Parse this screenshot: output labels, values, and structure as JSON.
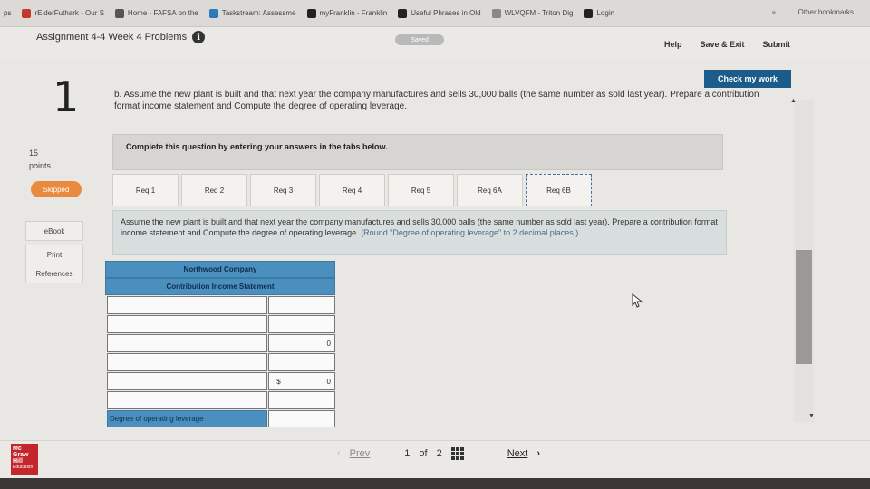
{
  "bookmarks": [
    {
      "label": "ps",
      "color": ""
    },
    {
      "label": "rElderFuthark - Our S",
      "color": "#c0392b"
    },
    {
      "label": "Home - FAFSA on the",
      "color": "#555555"
    },
    {
      "label": "Taskstream: Assessme",
      "color": "#2c7ab8"
    },
    {
      "label": "myFranklin - Franklin",
      "color": "#222222"
    },
    {
      "label": "Useful Phrases in Old",
      "color": "#222222"
    },
    {
      "label": "WLVQFM - Triton Dig",
      "color": "#888888"
    },
    {
      "label": "Login",
      "color": "#222222"
    }
  ],
  "bookmarks_chevron": "»",
  "other_bookmarks": "Other bookmarks",
  "header": {
    "assignment_title": "Assignment 4-4 Week 4 Problems",
    "info": "i",
    "saved": "Saved",
    "help": "Help",
    "save_exit": "Save & Exit",
    "submit": "Submit"
  },
  "sidebar": {
    "question_number": "1",
    "points_value": "15",
    "points_label": "points",
    "status": "Skipped",
    "ebook": "eBook",
    "print": "Print",
    "references": "References"
  },
  "main": {
    "check_my_work": "Check my work",
    "question_text": "b. Assume the new plant is built and that next year the company manufactures and sells 30,000 balls (the same number as sold last year). Prepare a contribution format income statement and Compute the degree of operating leverage.",
    "complete_instruction": "Complete this question by entering your answers in the tabs below.",
    "tabs": [
      "Req 1",
      "Req 2",
      "Req 3",
      "Req 4",
      "Req 5",
      "Req 6A",
      "Req 6B"
    ],
    "active_tab": "Req 6B",
    "panel_text": "Assume the new plant is built and that next year the company manufactures and sells 30,000 balls (the same number as sold last year). Prepare a contribution format income statement and Compute the degree of operating leverage.",
    "panel_hint": "(Round \"Degree of operating leverage\" to 2 decimal places.)"
  },
  "statement": {
    "company": "Northwood Company",
    "title": "Contribution Income Statement",
    "rows": [
      {
        "label": "",
        "value": "",
        "dollar": ""
      },
      {
        "label": "",
        "value": "",
        "dollar": ""
      },
      {
        "label": "",
        "value": "0",
        "dollar": ""
      },
      {
        "label": "",
        "value": "",
        "dollar": ""
      },
      {
        "label": "",
        "value": "0",
        "dollar": "$"
      },
      {
        "label": "",
        "value": "",
        "dollar": ""
      }
    ],
    "dol_label": "Degree of operating leverage",
    "dol_value": ""
  },
  "footer": {
    "logo_lines": [
      "Mc",
      "Graw",
      "Hill",
      "Education"
    ],
    "prev": "Prev",
    "page_current": "1",
    "page_of": "of",
    "page_total": "2",
    "next": "Next"
  }
}
